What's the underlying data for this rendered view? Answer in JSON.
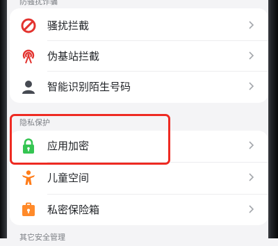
{
  "sections": {
    "top_partial_label": "防骚扰诈骗",
    "privacy_label": "隐私保护",
    "bottom_partial_label": "其它安全管理"
  },
  "items": {
    "harassment_block": "骚扰拦截",
    "fake_station_block": "伪基站拦截",
    "smart_caller_id": "智能识别陌生号码",
    "app_lock": "应用加密",
    "kids_space": "儿童空间",
    "private_safe": "私密保险箱"
  },
  "colors": {
    "harassment_icon": "#e3332f",
    "fake_station_icon": "#e3332f",
    "caller_id_icon": "#464a52",
    "app_lock_icon": "#35c552",
    "kids_space_icon": "#ff7d1a",
    "private_safe_icon": "#ff8a2a",
    "highlight": "#ee2a22"
  }
}
